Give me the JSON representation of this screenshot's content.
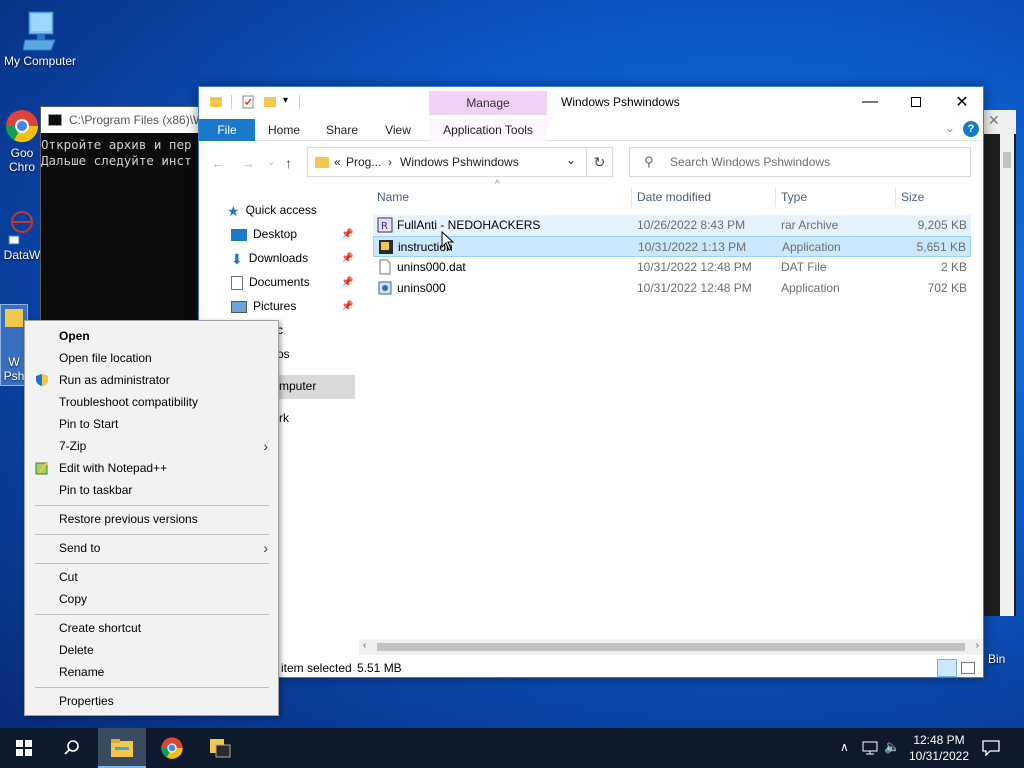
{
  "desktop": {
    "icons": [
      {
        "label": "My Computer"
      },
      {
        "label_line1": "Goo",
        "label_line2": "Chro"
      },
      {
        "label": "DataW"
      },
      {
        "label_line1": "W",
        "label_line2": "Psh"
      }
    ],
    "recycle_bin_label": "Bin"
  },
  "console": {
    "title": "C:\\Program Files (x86)\\W",
    "lines": [
      "Откройте архив и пер",
      "Дальше следуйте инст"
    ]
  },
  "explorer": {
    "title": "Windows Pshwindows",
    "manage_label": "Manage",
    "ribbon_tabs": {
      "file": "File",
      "home": "Home",
      "share": "Share",
      "view": "View",
      "app_tools": "Application Tools"
    },
    "breadcrumb": {
      "overflow": "«",
      "parent": "Prog...",
      "sep": "›",
      "current": "Windows Pshwindows"
    },
    "search_placeholder": "Search Windows Pshwindows",
    "nav": {
      "quick_access": "Quick access",
      "desktop": "Desktop",
      "downloads": "Downloads",
      "documents": "Documents",
      "pictures": "Pictures",
      "music_partial": "c",
      "videos_partial": "os",
      "computer_partial": "mputer",
      "network_partial": "rk"
    },
    "columns": {
      "name": "Name",
      "date": "Date modified",
      "type": "Type",
      "size": "Size"
    },
    "files": [
      {
        "name": "FullAnti - NEDOHACKERS",
        "date": "10/26/2022 8:43 PM",
        "type": "rar Archive",
        "size": "9,205 KB"
      },
      {
        "name": "instruction",
        "date": "10/31/2022 1:13 PM",
        "type": "Application",
        "size": "5,651 KB"
      },
      {
        "name": "unins000.dat",
        "date": "10/31/2022 12:48 PM",
        "type": "DAT File",
        "size": "2 KB"
      },
      {
        "name": "unins000",
        "date": "10/31/2022 12:48 PM",
        "type": "Application",
        "size": "702 KB"
      }
    ],
    "status": {
      "selected": "item selected",
      "size": "5.51 MB"
    }
  },
  "context_menu": {
    "items": [
      {
        "label": "Open"
      },
      {
        "label": "Open file location"
      },
      {
        "label": "Run as administrator"
      },
      {
        "label": "Troubleshoot compatibility"
      },
      {
        "label": "Pin to Start"
      },
      {
        "label": "7-Zip"
      },
      {
        "label": "Edit with Notepad++"
      },
      {
        "label": "Pin to taskbar"
      },
      {
        "label": "Restore previous versions"
      },
      {
        "label": "Send to"
      },
      {
        "label": "Cut"
      },
      {
        "label": "Copy"
      },
      {
        "label": "Create shortcut"
      },
      {
        "label": "Delete"
      },
      {
        "label": "Rename"
      },
      {
        "label": "Properties"
      }
    ]
  },
  "taskbar": {
    "time": "12:48 PM",
    "date": "10/31/2022"
  },
  "colors": {
    "accent": "#1979ca",
    "manage_tab": "#f0d2f7",
    "selection": "#cce8ff",
    "taskbar": "#0d1a2b"
  }
}
